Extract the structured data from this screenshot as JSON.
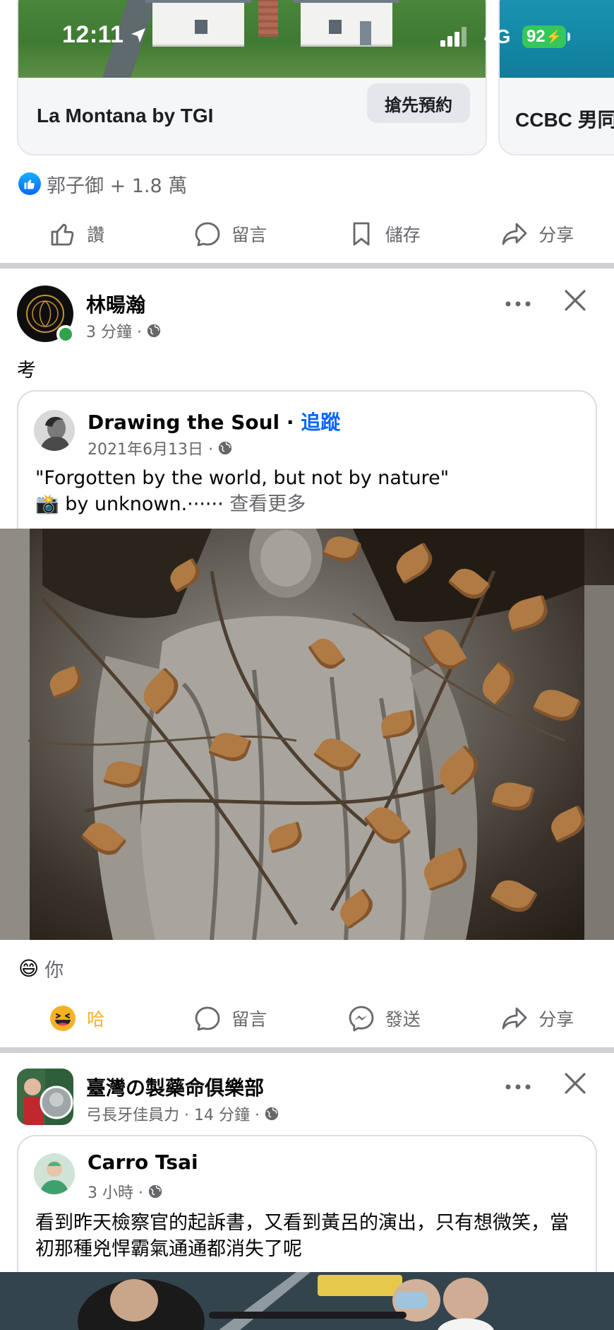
{
  "status_bar": {
    "time": "12:11",
    "network": "4G",
    "battery": "92"
  },
  "ad_carousel": {
    "cards": [
      {
        "title": "La Montana by TGI",
        "button": "搶先預約"
      },
      {
        "title": "CCBC 男同"
      }
    ]
  },
  "post1_footer": {
    "reactions_text": "郭子御 + 1.8 萬",
    "actions": {
      "like": "讚",
      "comment": "留言",
      "save": "儲存",
      "share": "分享"
    }
  },
  "post2": {
    "author": "林暘瀚",
    "time": "3 分鐘 ·",
    "text": "考",
    "shared": {
      "page": "Drawing the Soul",
      "follow_sep": " · ",
      "follow": "追蹤",
      "date": "2021年6月13日 ·",
      "line1": "\"Forgotten by the world, but not by nature\"",
      "line2_emoji": "📸",
      "line2": " by unknown.······ ",
      "see_more": "查看更多"
    },
    "reaction_emoji": "😄",
    "reactions_text": "你",
    "actions": {
      "haha": "哈",
      "comment": "留言",
      "send": "發送",
      "share": "分享"
    }
  },
  "post3": {
    "group": "臺灣の製藥命俱樂部",
    "meta": "弓長牙佳員力 · 14 分鐘 ·",
    "shared": {
      "author": "Carro Tsai",
      "time": "3 小時 ·",
      "text": "看到昨天檢察官的起訴書，又看到黃呂的演出，只有想微笑，當初那種兇悍霸氣通通都消失了呢"
    }
  },
  "colors": {
    "brand_blue": "#0866ff",
    "haha_yellow": "#f7b125",
    "online_green": "#31a24c",
    "battery_green": "#34c759"
  }
}
